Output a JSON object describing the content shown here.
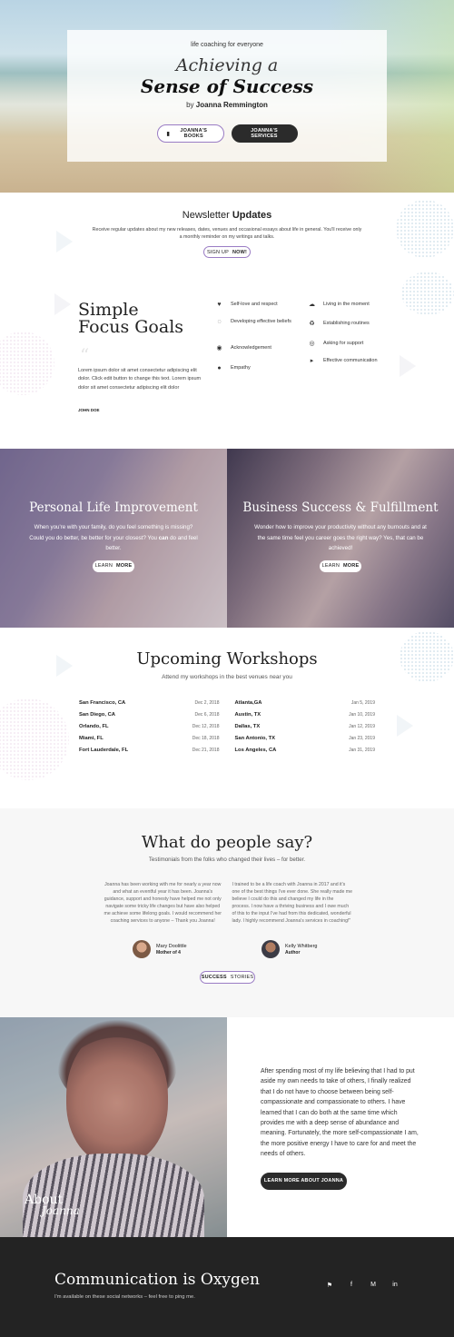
{
  "hero": {
    "kicker": "life coaching for everyone",
    "line1": "Achieving a",
    "line2": "Sense of Success",
    "by_prefix": "by",
    "author": "Joanna Remmington",
    "books_icon": "book-icon",
    "books_label": "JOANNA'S BOOKS",
    "services_label": "JOANNA'S SERVICES"
  },
  "newsletter": {
    "title_light": "Newsletter",
    "title_bold": "Updates",
    "text": "Receive regular updates about my new releases, dates, venues and occasional essays about life in general. You'll receive only a monthly reminder on my writings and talks.",
    "button_light": "SIGN UP",
    "button_bold": "NOW!"
  },
  "goals": {
    "title1": "Simple",
    "title2": "Focus Goals",
    "quote_mark": "“",
    "quote": "Lorem ipsum dolor sit amet consectetur adipiscing elit dolor. Click edit button to change this text. Lorem ipsum dolor sit amet consectetur adipiscing elit dolor",
    "author": "JOHN DOE",
    "items": [
      {
        "label": "Self-love and respect",
        "icon": "heart-icon"
      },
      {
        "label": "Developing effective beliefs",
        "icon": "lightbulb-icon"
      },
      {
        "label": "Acknowledgement",
        "icon": "eye-icon"
      },
      {
        "label": "Empathy",
        "icon": "people-icon"
      },
      {
        "label": "Living in the moment",
        "icon": "cloud-icon"
      },
      {
        "label": "Establishing routines",
        "icon": "recycle-icon"
      },
      {
        "label": "Asking for support",
        "icon": "lifebuoy-icon"
      },
      {
        "label": "Effective communication",
        "icon": "megaphone-icon"
      }
    ]
  },
  "panels": {
    "personal": {
      "title": "Personal Life Improvement",
      "text_before": "When you're with your family, do you feel something is missing? Could you do better, be better for your closest? You",
      "text_bold": "can",
      "text_after": "do and feel better.",
      "button_light": "LEARN",
      "button_bold": "MORE"
    },
    "business": {
      "title": "Business Success & Fulfillment",
      "text": "Wonder how to improve your productivity without any burnouts and at the same time feel you career goes the right way? Yes, that can be achieved!",
      "button_light": "LEARN",
      "button_bold": "MORE"
    }
  },
  "workshops": {
    "title": "Upcoming Workshops",
    "subtitle": "Attend my workshops in the best venues near you",
    "left": [
      {
        "city": "San Francisco, CA",
        "date": "Dec 2, 2018"
      },
      {
        "city": "San Diego, CA",
        "date": "Dec 6, 2018"
      },
      {
        "city": "Orlando, FL",
        "date": "Dec 12, 2018"
      },
      {
        "city": "Miami, FL",
        "date": "Dec 18, 2018"
      },
      {
        "city": "Fort Lauderdale, FL",
        "date": "Dec 21, 2018"
      }
    ],
    "right": [
      {
        "city": "Atlanta,GA",
        "date": "Jan 5, 2019"
      },
      {
        "city": "Austin, TX",
        "date": "Jan 10, 2019"
      },
      {
        "city": "Dallas, TX",
        "date": "Jan 12, 2019"
      },
      {
        "city": "San Antonio, TX",
        "date": "Jan 23, 2019"
      },
      {
        "city": "Los Angeles, CA",
        "date": "Jan 31, 2019"
      }
    ]
  },
  "testimonials": {
    "title": "What do people say?",
    "subtitle": "Testimonials from the folks who changed their lives – for better.",
    "left_text": "Joanna has been working with me for nearly a year now and what an eventful year it has been. Joanna's guidance, support and honesty have helped me not only navigate some tricky life changes but have also helped me achieve some lifelong goals. I would recommend her coaching services to anyone – Thank you Joanna!",
    "right_text": "I trained to be a life coach with Joanna in 2017 and it's one of the best things I've ever done. She really made me believe I could do this and changed my life in the process. I now have a thriving business and I owe much of this to the input I've had from this dedicated, wonderful lady. I highly recommend Joanna's services in coaching!\"",
    "left_name": "Mary Doolittle",
    "left_role": "Mother of 4",
    "right_name": "Kelly Whitberg",
    "right_role": "Author",
    "button_bold": "SUCCESS",
    "button_light": "STORIES"
  },
  "about": {
    "label1": "About",
    "label2": "Joanna",
    "text": "After spending most of my life believing that I had to put aside my own needs to take of others, I finally realized that I do not have to choose between being self-compassionate and compassionate to others. I have learned that I can do both at the same time which provides me with a deep sense of abundance and meaning. Fortunately, the more self-compassionate I am, the more positive energy I have to care for and meet the needs of others.",
    "button": "LEARN MORE ABOUT JOANNA"
  },
  "footer": {
    "title": "Communication is Oxygen",
    "subtitle": "I'm available on these social networks – feel free to ping me.",
    "social": [
      {
        "name": "twitter-icon",
        "glyph": "⚑"
      },
      {
        "name": "facebook-icon",
        "glyph": "f"
      },
      {
        "name": "medium-icon",
        "glyph": "M"
      },
      {
        "name": "linkedin-icon",
        "glyph": "in"
      }
    ]
  }
}
